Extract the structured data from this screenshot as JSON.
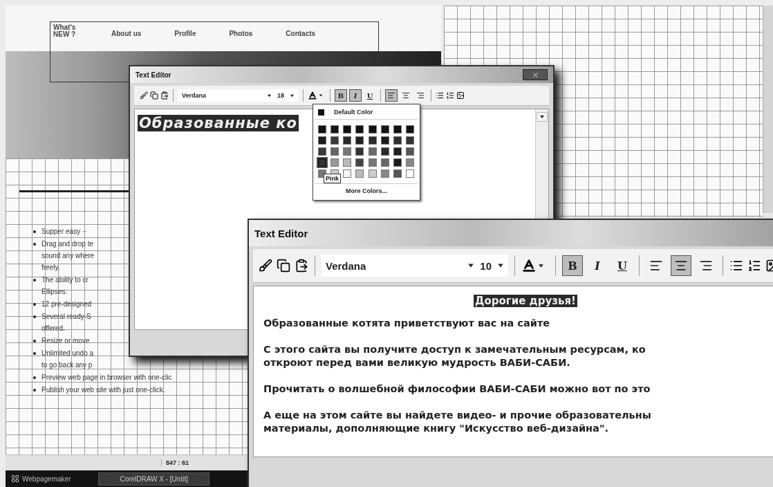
{
  "site_nav": {
    "items": [
      "What's NEW ?",
      "About us",
      "Profile",
      "Photos",
      "Contacts"
    ]
  },
  "feature_list": [
    {
      "lines": [
        "Supper easy ·· "
      ]
    },
    {
      "lines": [
        "Drag and drop te",
        "sound any where",
        "freely."
      ]
    },
    {
      "lines": [
        "The ability to cr",
        "Ellipses."
      ]
    },
    {
      "lines": [
        "12 pre-designed"
      ]
    },
    {
      "lines": [
        "Several ready-S",
        "offered."
      ]
    },
    {
      "lines": [
        "Resize or move"
      ]
    },
    {
      "lines": [
        "Unlimited undo a",
        "to go back any p"
      ]
    },
    {
      "lines": [
        "Preview web page in browser with one-clic"
      ]
    },
    {
      "lines": [
        "Publish your web site with just one-click."
      ]
    }
  ],
  "status_bar": {
    "position": "847 : 61"
  },
  "taskbar": [
    {
      "kind": "app",
      "label": "Webpagemaker"
    },
    {
      "kind": "task",
      "label": "CorelDRAW X - [Untit]"
    }
  ],
  "editors": [
    {
      "title": "Text Editor",
      "font": "Verdana",
      "size": "18",
      "format_buttons": [
        {
          "label": "B",
          "selected": true
        },
        {
          "label": "I",
          "selected": true
        },
        {
          "label": "U",
          "selected": false
        }
      ],
      "align": [
        {
          "kind": "left",
          "selected": true
        },
        {
          "kind": "center",
          "selected": false
        },
        {
          "kind": "right",
          "selected": false
        }
      ],
      "content": [
        {
          "kind": "highlight",
          "text": "Образованные ко"
        }
      ]
    },
    {
      "title": "Text Editor",
      "font": "Verdana",
      "size": "10",
      "format_buttons": [
        {
          "label": "B",
          "selected": true
        },
        {
          "label": "I",
          "selected": false
        },
        {
          "label": "U",
          "selected": false
        }
      ],
      "align": [
        {
          "kind": "left",
          "selected": false
        },
        {
          "kind": "center",
          "selected": true
        },
        {
          "kind": "right",
          "selected": false
        }
      ],
      "content": [
        {
          "kind": "heading",
          "text": "Дорогие друзья!"
        },
        {
          "kind": "para",
          "lines": [
            "Образованные котята приветствуют вас на сайте"
          ]
        },
        {
          "kind": "para",
          "lines": [
            "С этого сайта вы получите доступ к замечательным ресурсам, ко",
            "откроют перед вами великую мудрость ВАБИ-САБИ."
          ]
        },
        {
          "kind": "para",
          "lines": [
            "Прочитать о волшебной философии ВАБИ-САБИ можно вот по это"
          ]
        },
        {
          "kind": "para",
          "lines": [
            "А еще на этом сайте вы найдете видео- и прочие образовательны",
            "материалы, дополняющие книгу \"Искусство веб-дизайна\"."
          ]
        }
      ]
    }
  ],
  "color_menu": {
    "default_label": "Default Color",
    "more_label": "More Colors...",
    "tooltip": "Pink",
    "swatches": [
      [
        {
          "color": "#111111",
          "selected": false
        },
        {
          "color": "#151515",
          "selected": false
        },
        {
          "color": "#111111",
          "selected": false
        },
        {
          "color": "#131313",
          "selected": false
        },
        {
          "color": "#111111",
          "selected": false
        },
        {
          "color": "#151515",
          "selected": false
        },
        {
          "color": "#111111",
          "selected": false
        },
        {
          "color": "#131313",
          "selected": false
        }
      ],
      [
        {
          "color": "#1a1a1a",
          "selected": false
        },
        {
          "color": "#3a3a3a",
          "selected": false
        },
        {
          "color": "#2a2a2a",
          "selected": false
        },
        {
          "color": "#222222",
          "selected": false
        },
        {
          "color": "#2a2a2a",
          "selected": false
        },
        {
          "color": "#1a1a1a",
          "selected": false
        },
        {
          "color": "#2e2e2e",
          "selected": false
        },
        {
          "color": "#333333",
          "selected": false
        }
      ],
      [
        {
          "color": "#3a3a3a",
          "selected": false
        },
        {
          "color": "#666666",
          "selected": false
        },
        {
          "color": "#777777",
          "selected": false
        },
        {
          "color": "#333333",
          "selected": false
        },
        {
          "color": "#6a6a6a",
          "selected": false
        },
        {
          "color": "#2a2a2a",
          "selected": false
        },
        {
          "color": "#1e1e1e",
          "selected": false
        },
        {
          "color": "#555555",
          "selected": false
        }
      ],
      [
        {
          "color": "#333333",
          "selected": true
        },
        {
          "color": "#999999",
          "selected": false
        },
        {
          "color": "#bbbbbb",
          "selected": false
        },
        {
          "color": "#444444",
          "selected": false
        },
        {
          "color": "#777777",
          "selected": false
        },
        {
          "color": "#666666",
          "selected": false
        },
        {
          "color": "#1a1a1a",
          "selected": false
        },
        {
          "color": "#888888",
          "selected": false
        }
      ],
      [
        {
          "color": "#777777",
          "selected": false
        },
        {
          "color": "#cccccc",
          "selected": false
        },
        {
          "color": "#f4f4f4",
          "selected": false
        },
        {
          "color": "#bbbbbb",
          "selected": false
        },
        {
          "color": "#cccccc",
          "selected": false
        },
        {
          "color": "#888888",
          "selected": false
        },
        {
          "color": "#555555",
          "selected": false
        },
        {
          "color": "#ffffff",
          "selected": false
        }
      ]
    ]
  }
}
